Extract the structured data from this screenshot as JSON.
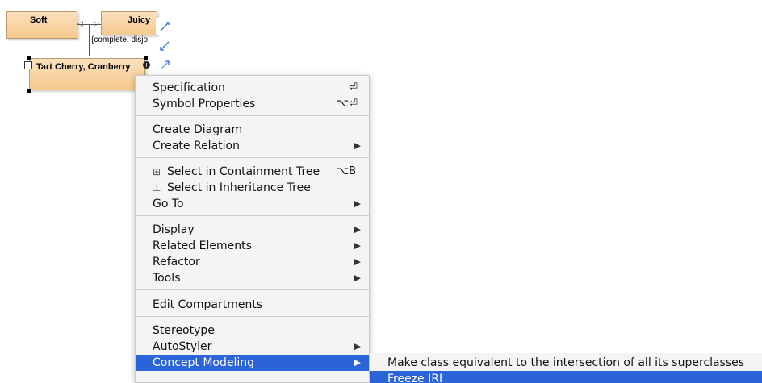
{
  "diagram": {
    "classes": {
      "soft": "Soft",
      "juicy": "Juicy",
      "tart_cherry": "Tart Cherry, Cranberry"
    },
    "generalization_set_label": "{complete, disjo"
  },
  "context_menu": {
    "groups": [
      [
        {
          "label": "Specification",
          "shortcut": "⏎",
          "submenu": false
        },
        {
          "label": "Symbol Properties",
          "shortcut": "⌥⏎",
          "submenu": false
        }
      ],
      [
        {
          "label": "Create Diagram",
          "shortcut": "",
          "submenu": false
        },
        {
          "label": "Create Relation",
          "shortcut": "",
          "submenu": true
        }
      ],
      [
        {
          "label": "Select in Containment Tree",
          "shortcut": "⌥B",
          "submenu": false,
          "icon": "containment-tree-icon"
        },
        {
          "label": "Select in Inheritance Tree",
          "shortcut": "",
          "submenu": false,
          "icon": "inheritance-tree-icon"
        },
        {
          "label": "Go To",
          "shortcut": "",
          "submenu": true
        }
      ],
      [
        {
          "label": "Display",
          "shortcut": "",
          "submenu": true
        },
        {
          "label": "Related Elements",
          "shortcut": "",
          "submenu": true
        },
        {
          "label": "Refactor",
          "shortcut": "",
          "submenu": true
        },
        {
          "label": "Tools",
          "shortcut": "",
          "submenu": true
        }
      ],
      [
        {
          "label": "Edit Compartments",
          "shortcut": "",
          "submenu": false
        }
      ],
      [
        {
          "label": "Stereotype",
          "shortcut": "",
          "submenu": false
        },
        {
          "label": "AutoStyler",
          "shortcut": "",
          "submenu": true
        },
        {
          "label": "Concept Modeling",
          "shortcut": "",
          "submenu": true,
          "active": true
        }
      ]
    ]
  },
  "submenu": {
    "items": [
      {
        "label": "Make class equivalent to the intersection of all its superclasses",
        "active": false
      },
      {
        "label": "Freeze IRI",
        "active": true
      }
    ]
  },
  "colors": {
    "highlight": "#2b63d9",
    "class_fill": "#f6c98d",
    "menu_bg": "#f4f4f4"
  }
}
